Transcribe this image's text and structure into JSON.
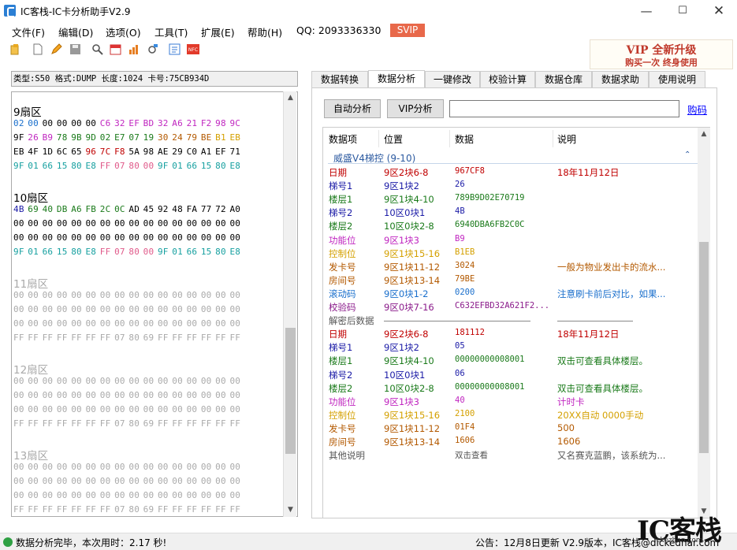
{
  "window": {
    "title": "IC客栈-IC卡分析助手V2.9"
  },
  "menu": [
    "文件(F)",
    "编辑(D)",
    "选项(O)",
    "工具(T)",
    "扩展(E)",
    "帮助(H)"
  ],
  "qq": "QQ:  2093336330",
  "svip": "SVIP",
  "vip_banner": {
    "title": "VIP 全新升级",
    "subtitle": "购买一次    终身使用"
  },
  "card_info": "类型:S50 格式:DUMP 长度:1024 卡号:75CB934D",
  "sectors": [
    {
      "title": "9扇区",
      "active": true,
      "rows": [
        [
          "02",
          "00",
          "00",
          "00",
          "00",
          "00",
          "C6",
          "32",
          "EF",
          "BD",
          "32",
          "A6",
          "21",
          "F2",
          "98",
          "9C"
        ],
        [
          "9F",
          "26",
          "B9",
          "78",
          "9B",
          "9D",
          "02",
          "E7",
          "07",
          "19",
          "30",
          "24",
          "79",
          "BE",
          "B1",
          "EB"
        ],
        [
          "EB",
          "4F",
          "1D",
          "6C",
          "65",
          "96",
          "7C",
          "F8",
          "5A",
          "98",
          "AE",
          "29",
          "C0",
          "A1",
          "EF",
          "71"
        ],
        [
          "9F",
          "01",
          "66",
          "15",
          "80",
          "E8",
          "FF",
          "07",
          "80",
          "00",
          "9F",
          "01",
          "66",
          "15",
          "80",
          "E8"
        ]
      ]
    },
    {
      "title": "10扇区",
      "active": true,
      "rows": [
        [
          "4B",
          "69",
          "40",
          "DB",
          "A6",
          "FB",
          "2C",
          "0C",
          "AD",
          "45",
          "92",
          "48",
          "FA",
          "77",
          "72",
          "A0"
        ],
        [
          "00",
          "00",
          "00",
          "00",
          "00",
          "00",
          "00",
          "00",
          "00",
          "00",
          "00",
          "00",
          "00",
          "00",
          "00",
          "00"
        ],
        [
          "00",
          "00",
          "00",
          "00",
          "00",
          "00",
          "00",
          "00",
          "00",
          "00",
          "00",
          "00",
          "00",
          "00",
          "00",
          "00"
        ],
        [
          "9F",
          "01",
          "66",
          "15",
          "80",
          "E8",
          "FF",
          "07",
          "80",
          "00",
          "9F",
          "01",
          "66",
          "15",
          "80",
          "E8"
        ]
      ]
    },
    {
      "title": "11扇区",
      "active": false,
      "rows": [
        [
          "00",
          "00",
          "00",
          "00",
          "00",
          "00",
          "00",
          "00",
          "00",
          "00",
          "00",
          "00",
          "00",
          "00",
          "00",
          "00"
        ],
        [
          "00",
          "00",
          "00",
          "00",
          "00",
          "00",
          "00",
          "00",
          "00",
          "00",
          "00",
          "00",
          "00",
          "00",
          "00",
          "00"
        ],
        [
          "00",
          "00",
          "00",
          "00",
          "00",
          "00",
          "00",
          "00",
          "00",
          "00",
          "00",
          "00",
          "00",
          "00",
          "00",
          "00"
        ],
        [
          "FF",
          "FF",
          "FF",
          "FF",
          "FF",
          "FF",
          "FF",
          "07",
          "80",
          "69",
          "FF",
          "FF",
          "FF",
          "FF",
          "FF",
          "FF"
        ]
      ]
    },
    {
      "title": "12扇区",
      "active": false,
      "rows": [
        [
          "00",
          "00",
          "00",
          "00",
          "00",
          "00",
          "00",
          "00",
          "00",
          "00",
          "00",
          "00",
          "00",
          "00",
          "00",
          "00"
        ],
        [
          "00",
          "00",
          "00",
          "00",
          "00",
          "00",
          "00",
          "00",
          "00",
          "00",
          "00",
          "00",
          "00",
          "00",
          "00",
          "00"
        ],
        [
          "00",
          "00",
          "00",
          "00",
          "00",
          "00",
          "00",
          "00",
          "00",
          "00",
          "00",
          "00",
          "00",
          "00",
          "00",
          "00"
        ],
        [
          "FF",
          "FF",
          "FF",
          "FF",
          "FF",
          "FF",
          "FF",
          "07",
          "80",
          "69",
          "FF",
          "FF",
          "FF",
          "FF",
          "FF",
          "FF"
        ]
      ]
    },
    {
      "title": "13扇区",
      "active": false,
      "rows": [
        [
          "00",
          "00",
          "00",
          "00",
          "00",
          "00",
          "00",
          "00",
          "00",
          "00",
          "00",
          "00",
          "00",
          "00",
          "00",
          "00"
        ],
        [
          "00",
          "00",
          "00",
          "00",
          "00",
          "00",
          "00",
          "00",
          "00",
          "00",
          "00",
          "00",
          "00",
          "00",
          "00",
          "00"
        ],
        [
          "00",
          "00",
          "00",
          "00",
          "00",
          "00",
          "00",
          "00",
          "00",
          "00",
          "00",
          "00",
          "00",
          "00",
          "00",
          "00"
        ],
        [
          "FF",
          "FF",
          "FF",
          "FF",
          "FF",
          "FF",
          "FF",
          "07",
          "80",
          "69",
          "FF",
          "FF",
          "FF",
          "FF",
          "FF",
          "FF"
        ]
      ]
    }
  ],
  "tabs": [
    "数据转换",
    "数据分析",
    "一键修改",
    "校验计算",
    "数据仓库",
    "数据求助",
    "使用说明"
  ],
  "active_tab": 1,
  "buttons": {
    "auto": "自动分析",
    "vip": "VIP分析"
  },
  "search_value": "",
  "buy_link": "购码",
  "columns": [
    "数据项",
    "位置",
    "数据",
    "说明"
  ],
  "group": "威盛V4梯控 (9-10)",
  "rows": [
    {
      "item": "日期",
      "pos": "9区2块6-8",
      "data": "967CF8",
      "desc": "18年11月12日",
      "color": "#c00000"
    },
    {
      "item": "梯号1",
      "pos": "9区1块2",
      "data": "26",
      "desc": "",
      "color": "#1a1aa6"
    },
    {
      "item": "楼层1",
      "pos": "9区1块4-10",
      "data": "789B9D02E70719",
      "desc": "",
      "color": "#1a7a1a"
    },
    {
      "item": "梯号2",
      "pos": "10区0块1",
      "data": "4B",
      "desc": "",
      "color": "#1a1aa6"
    },
    {
      "item": "楼层2",
      "pos": "10区0块2-8",
      "data": "6940DBA6FB2C0C",
      "desc": "",
      "color": "#1a7a1a"
    },
    {
      "item": "功能位",
      "pos": "9区1块3",
      "data": "B9",
      "desc": "",
      "color": "#c026c0"
    },
    {
      "item": "控制位",
      "pos": "9区1块15-16",
      "data": "B1EB",
      "desc": "",
      "color": "#d4a000"
    },
    {
      "item": "发卡号",
      "pos": "9区1块11-12",
      "data": "3024",
      "desc": "一般为物业发出卡的流水...",
      "color": "#b35900"
    },
    {
      "item": "房间号",
      "pos": "9区1块13-14",
      "data": "79BE",
      "desc": "",
      "color": "#b35900"
    },
    {
      "item": "滚动码",
      "pos": "9区0块1-2",
      "data": "0200",
      "desc": "注意刷卡前后对比，如果...",
      "color": "#1a6fcc"
    },
    {
      "item": "校验码",
      "pos": "9区0块7-16",
      "data": "C632EFBD32A621F2...",
      "desc": "",
      "color": "#8a1a8a"
    },
    {
      "item": "解密后数据",
      "pos": "",
      "data": "",
      "desc": "",
      "color": "#555555",
      "separator": true
    },
    {
      "item": "日期",
      "pos": "9区2块6-8",
      "data": "181112",
      "desc": "18年11月12日",
      "color": "#c00000"
    },
    {
      "item": "梯号1",
      "pos": "9区1块2",
      "data": "05",
      "desc": "",
      "color": "#1a1aa6"
    },
    {
      "item": "楼层1",
      "pos": "9区1块4-10",
      "data": "00000000008001",
      "desc": "双击可查看具体楼层。",
      "color": "#1a7a1a"
    },
    {
      "item": "梯号2",
      "pos": "10区0块1",
      "data": "06",
      "desc": "",
      "color": "#1a1aa6"
    },
    {
      "item": "楼层2",
      "pos": "10区0块2-8",
      "data": "00000000008001",
      "desc": "双击可查看具体楼层。",
      "color": "#1a7a1a"
    },
    {
      "item": "功能位",
      "pos": "9区1块3",
      "data": "40",
      "desc": "计时卡",
      "color": "#c026c0"
    },
    {
      "item": "控制位",
      "pos": "9区1块15-16",
      "data": "2100",
      "desc": "20XX自动 0000手动",
      "color": "#d4a000"
    },
    {
      "item": "发卡号",
      "pos": "9区1块11-12",
      "data": "01F4",
      "desc": "500",
      "color": "#b35900"
    },
    {
      "item": "房间号",
      "pos": "9区1块13-14",
      "data": "1606",
      "desc": "1606",
      "color": "#b35900"
    },
    {
      "item": "其他说明",
      "pos": "",
      "data": "双击查看",
      "desc": "又名赛克蓝鹏，该系统为...",
      "color": "#555555"
    }
  ],
  "status": "数据分析完毕，本次用时：2.17 秒!",
  "notice": "公告：12月8日更新 V2.9版本，IC客栈@dickedhar.com",
  "watermark": "IC客栈",
  "watermark_sub": "ickezhan.com",
  "colors": {
    "accent": "#e8684a",
    "link": "#0000ff",
    "hex_dim": "#aaaaaa"
  },
  "icons": [
    "open-icon",
    "new-icon",
    "edit-icon",
    "save-icon",
    "search-icon",
    "calendar-icon",
    "chart-icon",
    "tools-icon",
    "compare-icon",
    "nfc-icon"
  ]
}
